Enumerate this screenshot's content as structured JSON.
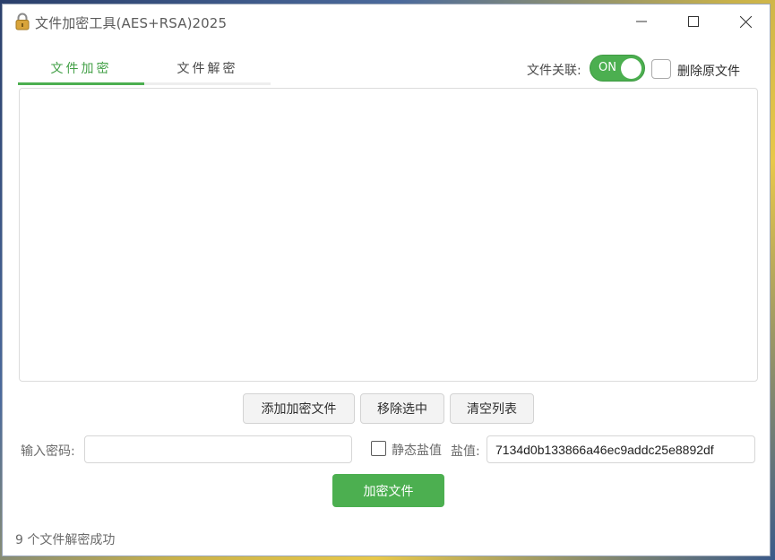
{
  "window": {
    "title": "文件加密工具(AES+RSA)2025",
    "icon": "padlock-icon"
  },
  "tabs": [
    {
      "label": "文件加密",
      "active": true
    },
    {
      "label": "文件解密",
      "active": false
    }
  ],
  "association": {
    "label": "文件关联:",
    "toggle_text": "ON",
    "toggle_on": true,
    "delete_original_label": "删除原文件",
    "delete_original_checked": false
  },
  "actions": {
    "add_label": "添加加密文件",
    "remove_label": "移除选中",
    "clear_label": "清空列表"
  },
  "password": {
    "label": "输入密码:",
    "value": "",
    "placeholder": ""
  },
  "salt": {
    "static_label": "静态盐值",
    "static_checked": false,
    "label": "盐值:",
    "value": "7134d0b133866a46ec9addc25e8892df"
  },
  "encrypt_button_label": "加密文件",
  "status_text": "9 个文件解密成功",
  "colors": {
    "accent": "#4caf50",
    "accent_text": "#43a047"
  }
}
